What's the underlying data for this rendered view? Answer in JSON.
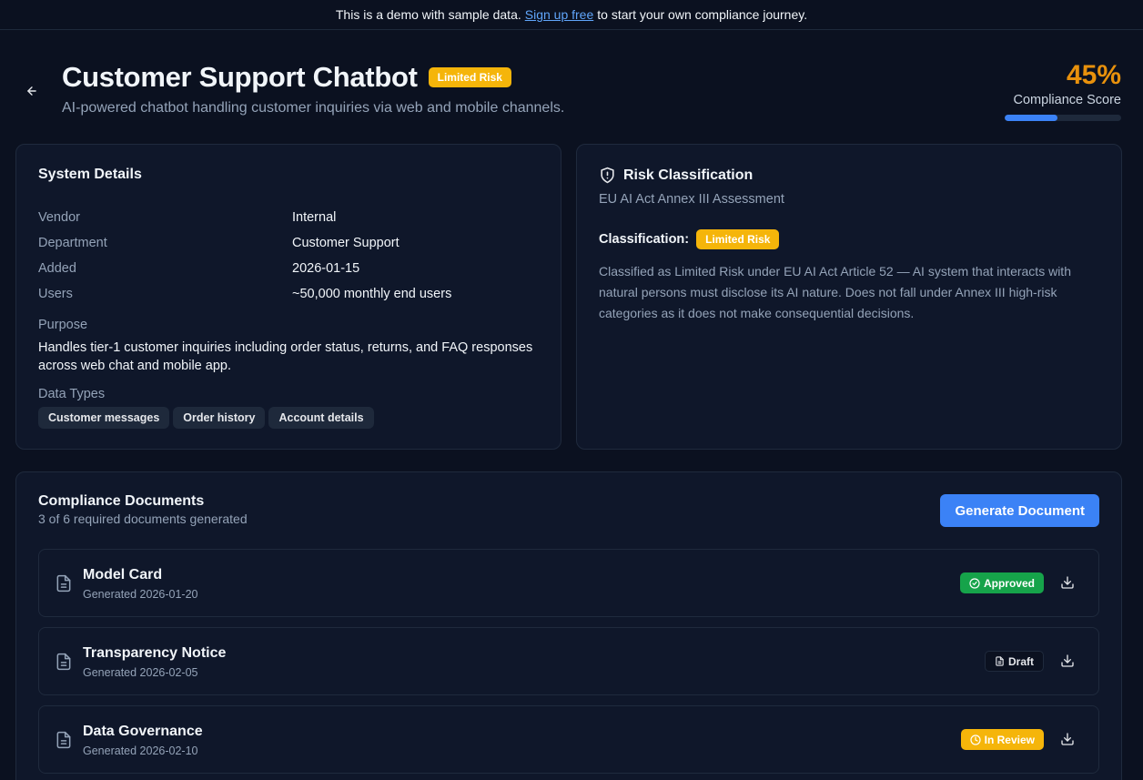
{
  "banner": {
    "prefix": "This is a demo with sample data.",
    "link": "Sign up free",
    "suffix": "to start your own compliance journey."
  },
  "header": {
    "back_icon": "arrow-left-icon",
    "title": "Customer Support Chatbot",
    "risk_badge": "Limited Risk",
    "subtitle": "AI-powered chatbot handling customer inquiries via web and mobile channels."
  },
  "score": {
    "value": "45%",
    "label": "Compliance Score",
    "progress": 0.45
  },
  "system_details": {
    "title": "System Details",
    "rows": [
      {
        "label": "Vendor",
        "value": "Internal"
      },
      {
        "label": "Department",
        "value": "Customer Support"
      },
      {
        "label": "Added",
        "value": "2026-01-15"
      },
      {
        "label": "Users",
        "value": "~50,000 monthly end users"
      }
    ],
    "purpose_label": "Purpose",
    "purpose": "Handles tier-1 customer inquiries including order status, returns, and FAQ responses across web chat and mobile app.",
    "data_types_label": "Data Types",
    "data_types": [
      "Customer messages",
      "Order history",
      "Account details"
    ]
  },
  "risk": {
    "icon": "shield-alert-icon",
    "title": "Risk Classification",
    "subtitle": "EU AI Act Annex III Assessment",
    "classification_label": "Classification:",
    "classification": "Limited Risk",
    "description": "Classified as Limited Risk under EU AI Act Article 52 — AI system that interacts with natural persons must disclose its AI nature. Does not fall under Annex III high-risk categories as it does not make consequential decisions."
  },
  "documents": {
    "title": "Compliance Documents",
    "subtitle": "3 of 6 required documents generated",
    "generate_label": "Generate Document",
    "items": [
      {
        "name": "Model Card",
        "date": "Generated 2026-01-20",
        "status": "Approved",
        "status_icon": "check-circle-icon"
      },
      {
        "name": "Transparency Notice",
        "date": "Generated 2026-02-05",
        "status": "Draft",
        "status_icon": "file-icon"
      },
      {
        "name": "Data Governance",
        "date": "Generated 2026-02-10",
        "status": "In Review",
        "status_icon": "clock-icon"
      }
    ]
  },
  "colors": {
    "background": "#0b1120",
    "card": "#0f172a",
    "accent": "#3b82f6",
    "warning": "#f5b50a",
    "score": "#e8910c",
    "success": "#16a34a"
  }
}
